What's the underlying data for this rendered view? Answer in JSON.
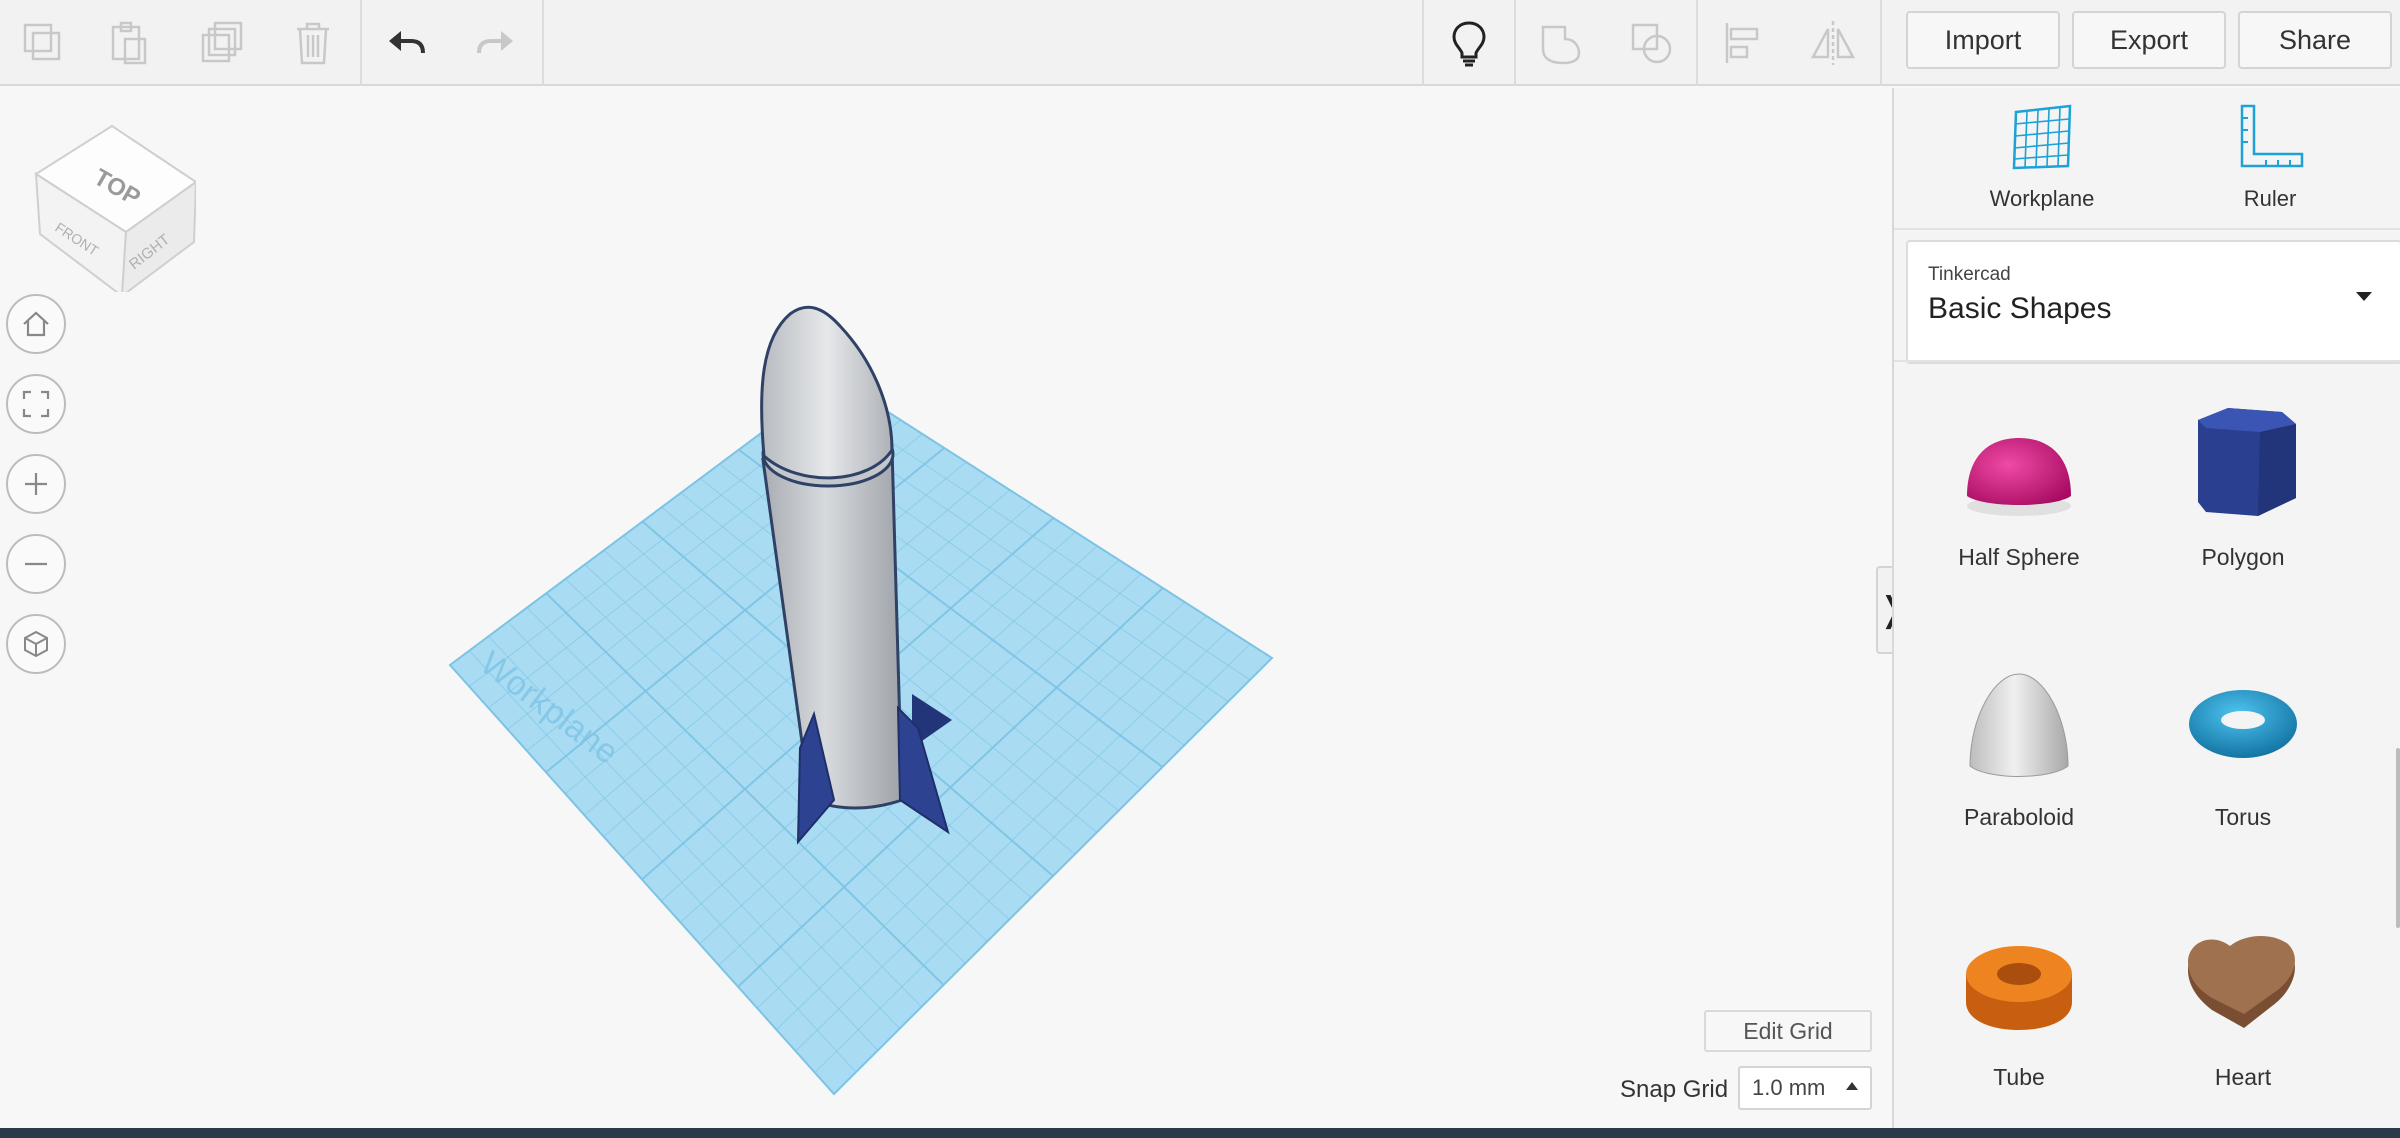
{
  "toolbar": {
    "left_tools": [
      {
        "name": "copy-icon",
        "enabled": false
      },
      {
        "name": "paste-icon",
        "enabled": false
      },
      {
        "name": "duplicate-icon",
        "enabled": false
      },
      {
        "name": "trash-icon",
        "enabled": false
      },
      {
        "name": "undo-icon",
        "enabled": true
      },
      {
        "name": "redo-icon",
        "enabled": false
      }
    ],
    "right_tools": [
      {
        "name": "lightbulb-icon",
        "enabled": true
      },
      {
        "name": "group-icon",
        "enabled": false
      },
      {
        "name": "ungroup-icon",
        "enabled": false
      },
      {
        "name": "align-icon",
        "enabled": false
      },
      {
        "name": "mirror-icon",
        "enabled": false
      }
    ],
    "import_label": "Import",
    "export_label": "Export",
    "share_label": "Share"
  },
  "viewport": {
    "view_cube": {
      "top": "TOP",
      "front": "FRONT",
      "right": "RIGHT"
    },
    "nav_controls": [
      "home-icon",
      "fit-view-icon",
      "zoom-in-icon",
      "zoom-out-icon",
      "orthographic-icon"
    ],
    "workplane_watermark": "Workplane",
    "edit_grid_label": "Edit Grid",
    "snap_grid_label": "Snap Grid",
    "snap_grid_value": "1.0 mm"
  },
  "panel": {
    "workplane_label": "Workplane",
    "ruler_label": "Ruler",
    "library_source": "Tinkercad",
    "library_name": "Basic Shapes",
    "shapes": [
      {
        "label": "Half Sphere",
        "icon": "half-sphere-icon",
        "color": "#d4127f"
      },
      {
        "label": "Polygon",
        "icon": "polygon-icon",
        "color": "#2a3f8f"
      },
      {
        "label": "Paraboloid",
        "icon": "paraboloid-icon",
        "color": "#d9d9d9"
      },
      {
        "label": "Torus",
        "icon": "torus-icon",
        "color": "#1a8fc4"
      },
      {
        "label": "Tube",
        "icon": "tube-icon",
        "color": "#e07418"
      },
      {
        "label": "Heart",
        "icon": "heart-icon",
        "color": "#8a5a3c"
      }
    ]
  },
  "colors": {
    "workplane": "#a9dcf2",
    "grid_line": "#7cc3e4",
    "rocket_body": "#c9ccd0",
    "rocket_fins": "#2d4291",
    "accent": "#1da1d6"
  }
}
